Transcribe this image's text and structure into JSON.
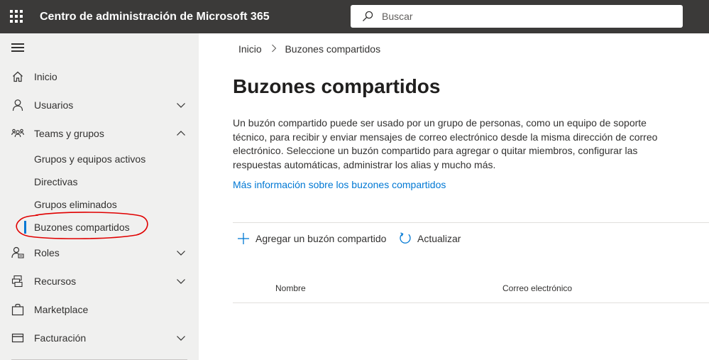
{
  "header": {
    "app_title": "Centro de administración de Microsoft 365",
    "search_placeholder": "Buscar",
    "background_color": "#3b3a39"
  },
  "sidebar": {
    "items": [
      {
        "label": "Inicio",
        "icon": "home-icon"
      },
      {
        "label": "Usuarios",
        "icon": "user-icon",
        "chevron": "down"
      },
      {
        "label": "Teams y grupos",
        "icon": "teams-groups-icon",
        "chevron": "up",
        "expanded": true
      },
      {
        "label": "Roles",
        "icon": "roles-icon",
        "chevron": "down"
      },
      {
        "label": "Recursos",
        "icon": "resources-icon",
        "chevron": "down"
      },
      {
        "label": "Marketplace",
        "icon": "marketplace-bag-icon"
      },
      {
        "label": "Facturación",
        "icon": "billing-card-icon",
        "chevron": "down"
      }
    ],
    "teams_subitems": [
      {
        "label": "Grupos y equipos activos"
      },
      {
        "label": "Directivas"
      },
      {
        "label": "Grupos eliminados"
      },
      {
        "label": "Buzones compartidos",
        "selected": true
      }
    ],
    "background_color": "#f0f0ef",
    "selected_accent": "#0078d4",
    "annotation_color": "#e00000"
  },
  "breadcrumb": {
    "home": "Inicio",
    "current": "Buzones compartidos"
  },
  "main": {
    "title": "Buzones compartidos",
    "description": "Un buzón compartido puede ser usado por un grupo de personas, como un equipo de soporte técnico, para recibir y enviar mensajes de correo electrónico desde la misma dirección de correo electrónico. Seleccione un buzón compartido para agregar o quitar miembros, configurar las respuestas automáticas, administrar los alias y mucho más.",
    "learn_more_link": "Más información sobre los buzones compartidos",
    "link_color": "#0078d4"
  },
  "commands": {
    "add_label": "Agregar un buzón compartido",
    "refresh_label": "Actualizar"
  },
  "table": {
    "columns": [
      "Nombre",
      "Correo electrónico"
    ]
  }
}
